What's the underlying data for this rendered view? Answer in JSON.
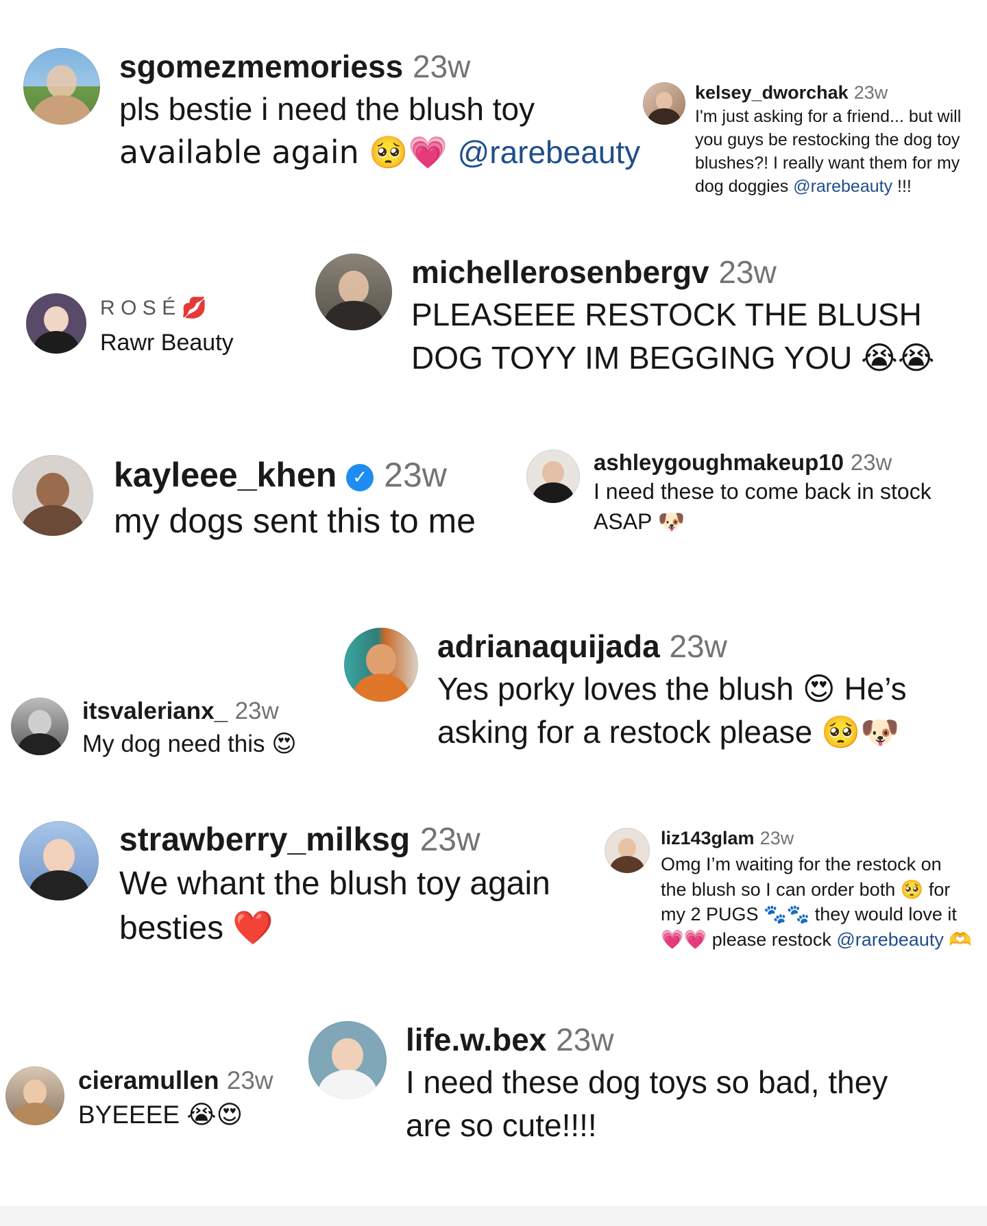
{
  "comments": [
    {
      "user": "sgomezmemoriess",
      "time": "23w",
      "lines": [
        "pls bestie i need the blush toy",
        "available again 🥺💗 "
      ],
      "mention": "@rarebeauty"
    },
    {
      "user": "kelsey_dworchak",
      "time": "23w",
      "lines": [
        "I'm just asking for a friend... but will",
        "you guys be restocking the dog toy",
        "blushes?! I really want them for my",
        "dog doggies "
      ],
      "mention": "@rarebeauty",
      "suffix": " !!!"
    },
    {
      "user": "ROSÉ",
      "badge": "💋",
      "lines": [
        "Rawr Beauty"
      ]
    },
    {
      "user": "michellerosenbergv",
      "time": "23w",
      "lines": [
        "PLEASEEE RESTOCK THE BLUSH",
        "DOG TOYY IM BEGGING YOU 😭😭"
      ]
    },
    {
      "user": "kayleee_khen",
      "verified": "✓",
      "time": "23w",
      "lines": [
        "my dogs sent this to me"
      ]
    },
    {
      "user": "ashleygoughmakeup10",
      "time": "23w",
      "lines": [
        "I need these to come back in stock",
        "ASAP 🐶"
      ]
    },
    {
      "user": "adrianaquijada",
      "time": "23w",
      "lines": [
        "Yes porky loves the blush 😍 He’s",
        "asking for a restock please 🥺🐶"
      ]
    },
    {
      "user": "itsvalerianx_",
      "time": "23w",
      "lines": [
        "My dog need this 😍"
      ]
    },
    {
      "user": "strawberry_milksg",
      "time": "23w",
      "lines": [
        "We whant the blush toy again",
        "besties ❤️"
      ]
    },
    {
      "user": "liz143glam",
      "time": "23w",
      "lines": [
        "Omg I’m waiting for the restock on",
        "the blush so I can order both 🥺 for",
        "my 2 PUGS 🐾🐾 they would love it",
        "💗💗 please restock "
      ],
      "mention": "@rarebeauty",
      "suffix": " 🫶"
    },
    {
      "user": "cieramullen",
      "time": "23w",
      "lines": [
        "BYEEEE 😭😍"
      ]
    },
    {
      "user": "life.w.bex",
      "time": "23w",
      "lines": [
        "I need these dog toys so bad, they",
        "are so cute!!!!"
      ]
    }
  ],
  "colors": {
    "mention": "#1f4e8a",
    "timestamp": "#737373",
    "verified": "#1e8cf0"
  }
}
